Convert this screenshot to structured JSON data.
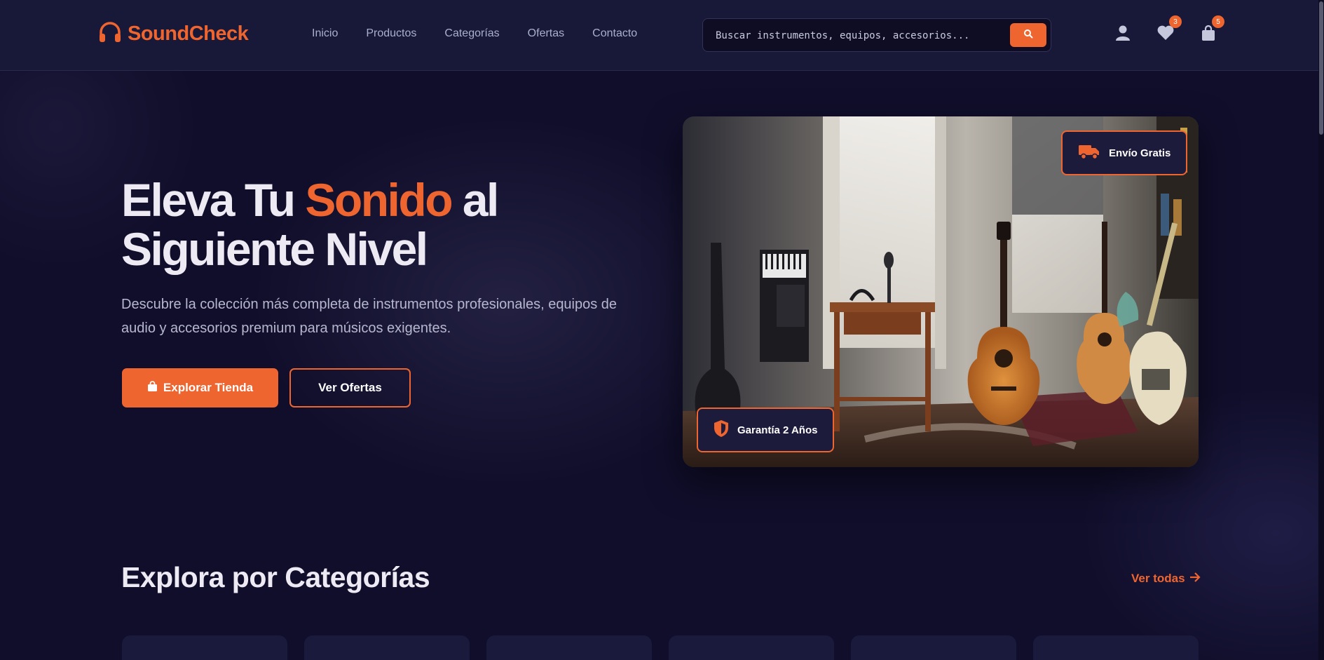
{
  "brand": {
    "name": "SoundCheck",
    "accent_color": "#ef6530",
    "logo_icon": "headphones-icon"
  },
  "nav": {
    "items": [
      {
        "label": "Inicio"
      },
      {
        "label": "Productos"
      },
      {
        "label": "Categorías"
      },
      {
        "label": "Ofertas"
      },
      {
        "label": "Contacto"
      }
    ]
  },
  "search": {
    "placeholder": "Buscar instrumentos, equipos, accesorios...",
    "button_icon": "search-icon"
  },
  "header_actions": {
    "account_icon": "user-icon",
    "wishlist": {
      "icon": "heart-icon",
      "count": "3"
    },
    "cart": {
      "icon": "shopping-bag-icon",
      "count": "5"
    }
  },
  "hero": {
    "title_part1": "Eleva Tu ",
    "title_accent": "Sonido",
    "title_part2": " al Siguiente Nivel",
    "description": "Descubre la colección más completa de instrumentos profesionales, equipos de audio y accesorios premium para músicos exigentes.",
    "primary_button": "Explorar Tienda",
    "secondary_button": "Ver Ofertas",
    "image_alt_subject": "music studio with guitars",
    "badges": {
      "shipping": "Envío Gratis",
      "warranty": "Garantía 2 Años"
    }
  },
  "categories": {
    "title": "Explora por Categorías",
    "view_all": "Ver todas"
  }
}
